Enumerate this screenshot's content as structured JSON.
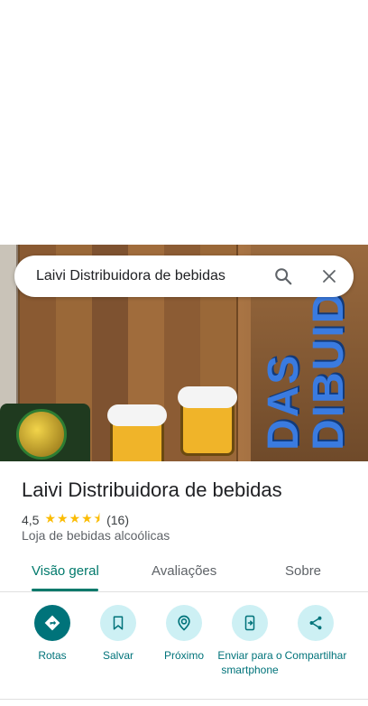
{
  "search": {
    "query": "Laivi Distribuidora de bebidas"
  },
  "place": {
    "name": "Laivi Distribuidora de bebidas",
    "rating": "4,5",
    "stars": "★★★★⯨",
    "reviews": "(16)",
    "category": "Loja de bebidas alcoólicas"
  },
  "tabs": [
    {
      "label": "Visão geral",
      "active": true
    },
    {
      "label": "Avaliações",
      "active": false
    },
    {
      "label": "Sobre",
      "active": false
    }
  ],
  "actions": [
    {
      "label": "Rotas",
      "icon": "directions-icon"
    },
    {
      "label": "Salvar",
      "icon": "bookmark-icon"
    },
    {
      "label": "Próximo",
      "icon": "nearby-icon"
    },
    {
      "label": "Enviar para o smartphone",
      "icon": "send-to-phone-icon"
    },
    {
      "label": "Compartilhar",
      "icon": "share-icon"
    }
  ],
  "colors": {
    "accent": "#00737a",
    "star": "#fbbc04",
    "chip": "#cdf0f4"
  }
}
